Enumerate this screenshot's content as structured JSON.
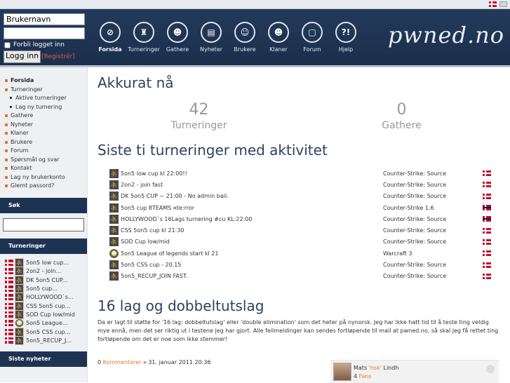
{
  "login": {
    "username_value": "Brukernavn",
    "password_value": "",
    "remember_label": "Forbli logget inn",
    "login_button": "Logg inn",
    "register_label": "[Registrér]"
  },
  "nav": [
    {
      "label": "Forsida",
      "icon": "helmet-icon",
      "glyph": "⊘"
    },
    {
      "label": "Turneringer",
      "icon": "trophy-icon",
      "glyph": "♜"
    },
    {
      "label": "Gathere",
      "icon": "group-icon",
      "glyph": "☻"
    },
    {
      "label": "Nyheter",
      "icon": "book-icon",
      "glyph": "▤"
    },
    {
      "label": "Brukere",
      "icon": "user-icon",
      "glyph": "☺"
    },
    {
      "label": "Klaner",
      "icon": "clan-icon",
      "glyph": "☻"
    },
    {
      "label": "Forum",
      "icon": "forum-icon",
      "glyph": "▢"
    },
    {
      "label": "Hjelp",
      "icon": "help-icon",
      "glyph": "?!"
    }
  ],
  "logo_text": "pwned.no",
  "sidebar": {
    "items": [
      "Forsida",
      "Turneringer",
      "Aktive turneringer",
      "Lag ny turnering",
      "Gathere",
      "Nyheter",
      "Klaner",
      "Brukere",
      "Forum",
      "Spørsmål og svar",
      "Kontakt",
      "Lag ny brukerkonto",
      "Glemt passord?"
    ],
    "search_heading": "Søk",
    "tournaments_heading": "Turneringer",
    "tournaments": [
      "5on5 low cup...",
      "2on2 - join...",
      "DK 5on5 CUP...",
      "5on5 cup...",
      "HOLLYWOOD`s...",
      "CSS 5on5 cup...",
      "SOD Cup low/mid",
      "5on5 League...",
      "5on5 CSS cup...",
      "5on5_RECUP_J..."
    ],
    "news_heading": "Siste nyheter"
  },
  "main": {
    "now_title": "Akkurat nå",
    "stat1_value": "42",
    "stat1_label": "Turneringer",
    "stat2_value": "0",
    "stat2_label": "Gathere",
    "recent_title": "Siste ti turneringer med aktivitet",
    "tournaments": [
      {
        "name": "5on5 low cup kl 22:00!!",
        "game": "Counter-Strike: Source",
        "flag": "dk"
      },
      {
        "name": "2on2 - join fast",
        "game": "Counter-Strike: Source",
        "flag": "dk"
      },
      {
        "name": "DK 5on5 CUP ~ 21:00 - No admin bail.",
        "game": "Counter-Strike: Source",
        "flag": "dk"
      },
      {
        "name": "5on5 cup 8TEAMS ¤te:rror",
        "game": "Counter-Strike 1.6",
        "flag": "no"
      },
      {
        "name": "HOLLYWOOD`s 16Lags turnering #cu KL:22:00",
        "game": "Counter-Strike: Source",
        "flag": "no"
      },
      {
        "name": "CSS 5on5 cup kl 21:30",
        "game": "Counter-Strike: Source",
        "flag": "dk"
      },
      {
        "name": "SOD Cup low/mid",
        "game": "Counter-Strike: Source",
        "flag": "dk"
      },
      {
        "name": "5on5 League of legends start kl 21",
        "game": "Warcraft 3",
        "flag": "dk"
      },
      {
        "name": "5on5 CSS cup - 20.15",
        "game": "Counter-Strike: Source",
        "flag": "dk"
      },
      {
        "name": "5on5_RECUP_JOIN FAST.",
        "game": "Counter-Strike: Source",
        "flag": "dk"
      }
    ],
    "news_title": "16 lag og dobbeltutslag",
    "news_body": "Da er lagt til støtte for '16 lag: dobbeltutslag' eller 'double elimination' som det heter på nynorsk. Jeg har ikke hatt tid til å teste ting veldig mye ennå, men det ser riktig ut i testene jeg har gjort. Alle feilmeldinger kan sendes fortløpende til mail at pwned.no, så skal jeg få rettet ting fortløpende om det er noe som ikke stemmer!",
    "comments_count": "0",
    "comments_label": "Kommentarer",
    "date": "» 31. januar 2011 20:36",
    "author_first": "Mats",
    "author_nick": "'hsk'",
    "author_last": "Lindh",
    "fans_count": "4",
    "fans_label": "Fans"
  }
}
